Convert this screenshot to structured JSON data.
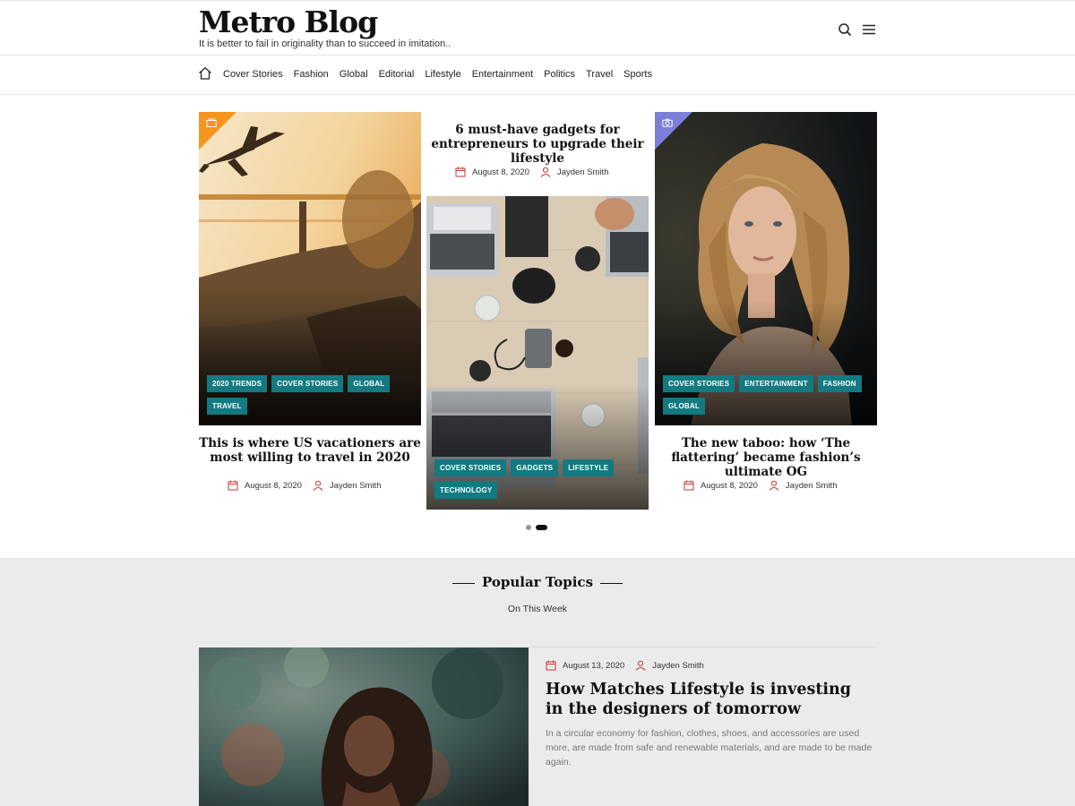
{
  "site": {
    "title": "Metro Blog",
    "tagline": "It is better to fail in originality than to succeed in imitation.."
  },
  "header_icons": [
    "search-icon",
    "hamburger-menu-icon"
  ],
  "nav": {
    "home_icon": "home-icon",
    "items": [
      "Cover Stories",
      "Fashion",
      "Global",
      "Editorial",
      "Lifestyle",
      "Entertainment",
      "Politics",
      "Travel",
      "Sports"
    ]
  },
  "slider": {
    "cards": [
      {
        "title": "This is where US vacationers are most willing to travel in 2020",
        "date": "August 8, 2020",
        "author": "Jayden Smith",
        "tags": [
          "2020 Trends",
          "Cover Stories",
          "Global",
          "Travel"
        ],
        "format_icon": "gallery-icon",
        "corner_color": "#f7941d"
      },
      {
        "title": "6 must-have gadgets for entrepreneurs to upgrade their lifestyle",
        "date": "August 8, 2020",
        "author": "Jayden Smith",
        "tags": [
          "Cover Stories",
          "Gadgets",
          "Lifestyle",
          "Technology"
        ]
      },
      {
        "title": "The new taboo: how ‘The flattering’ became fashion’s ultimate OG",
        "date": "August 8, 2020",
        "author": "Jayden Smith",
        "tags": [
          "Cover Stories",
          "Entertainment",
          "Fashion",
          "Global"
        ],
        "format_icon": "camera-icon",
        "corner_color": "#7b7fd8"
      }
    ],
    "pages": 2,
    "active_page": 2
  },
  "popular": {
    "title": "Popular Topics",
    "subtitle": "On This Week",
    "post": {
      "date": "August 13, 2020",
      "author": "Jayden Smith",
      "title": "How Matches Lifestyle is investing in the designers of tomorrow",
      "excerpt": "In a circular economy for fashion, clothes, shoes, and accessories are used more, are made from safe and renewable materials, and are made to be made again."
    }
  },
  "colors": {
    "tag_bg": "#127a80",
    "meta_icon": "#c0392b",
    "section_bg": "#ebebeb"
  }
}
